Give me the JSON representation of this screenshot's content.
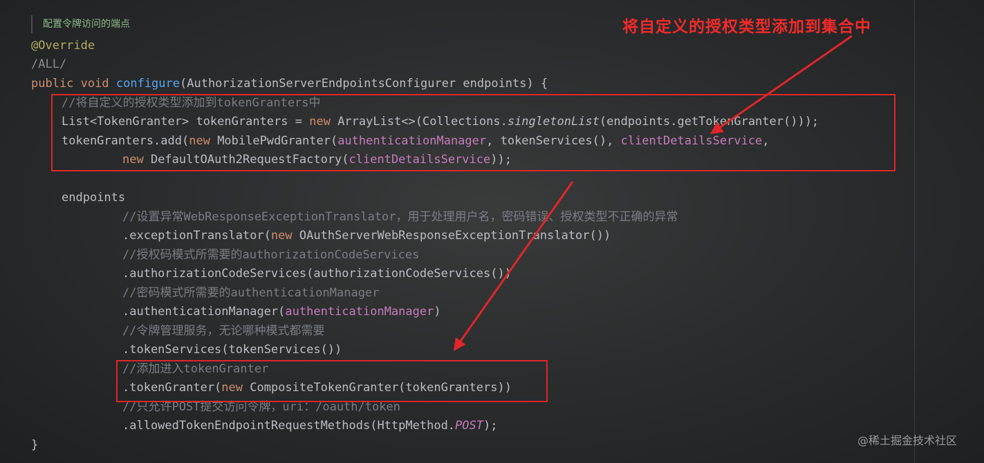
{
  "doc_comment": "配置令牌访问的端点",
  "annotation_note": "将自定义的授权类型添加到集合中",
  "watermark": "@稀土掘金技术社区",
  "code": {
    "l1": "@Override",
    "l2": "/ALL/",
    "l3": {
      "kw1": "public",
      "kw2": "void",
      "method": "configure",
      "rest": "(AuthorizationServerEndpointsConfigurer endpoints) {"
    },
    "l4": "//将自定义的授权类型添加到tokenGranters中",
    "l5": {
      "a": "List<TokenGranter> tokenGranters = ",
      "kw": "new",
      "b": " ArrayList<>(Collections.",
      "c": "singletonList",
      "d": "(endpoints.getTokenGranter()));"
    },
    "l6": {
      "a": "tokenGranters.add(",
      "kw": "new",
      "b": " MobilePwdGranter(",
      "f1": "authenticationManager",
      "c": ", tokenServices(), ",
      "f2": "clientDetailsService",
      "d": ","
    },
    "l7": {
      "kw": "new",
      "b": " DefaultOAuth2RequestFactory(",
      "f": "clientDetailsService",
      "d": "));"
    },
    "l8": "endpoints",
    "l9": "//设置异常WebResponseExceptionTranslator，用于处理用户名，密码错误、授权类型不正确的异常",
    "l10": {
      "a": ".exceptionTranslator(",
      "kw": "new",
      "b": " OAuthServerWebResponseExceptionTranslator())"
    },
    "l11": "//授权码模式所需要的authorizationCodeServices",
    "l12": ".authorizationCodeServices(authorizationCodeServices())",
    "l13": "//密码模式所需要的authenticationManager",
    "l14": {
      "a": ".authenticationManager(",
      "f": "authenticationManager",
      "b": ")"
    },
    "l15": "//令牌管理服务，无论哪种模式都需要",
    "l16": ".tokenServices(tokenServices())",
    "l17": "//添加进入tokenGranter",
    "l18": {
      "a": ".tokenGranter(",
      "kw": "new",
      "b": " CompositeTokenGranter(tokenGranters))"
    },
    "l19": "//只允许POST提交访问令牌，uri：/oauth/token",
    "l20": {
      "a": ".allowedTokenEndpointRequestMethods(HttpMethod.",
      "f": "POST",
      "b": ");"
    },
    "l21": "}"
  },
  "colors": {
    "keyword": "#cf8e6d",
    "annotation": "#b3ae60",
    "method": "#56a8f5",
    "field": "#c77dbb",
    "comment": "#7a7e85",
    "highlight_box": "#e0262a",
    "note_text": "#f22a2a"
  }
}
